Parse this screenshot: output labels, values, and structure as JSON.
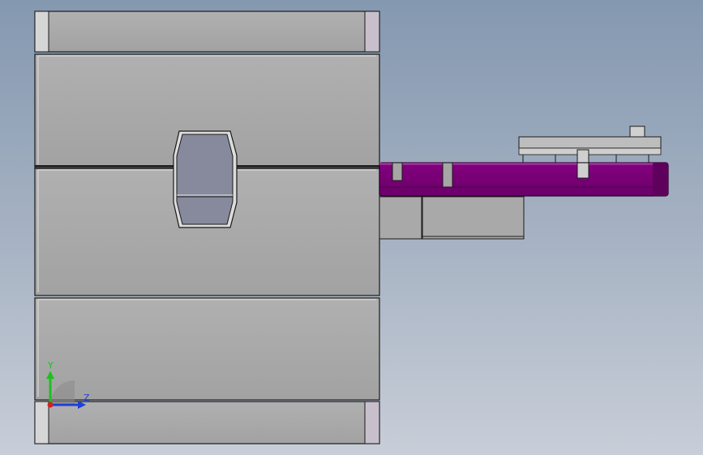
{
  "viewport": {
    "background_top": "#8498b0",
    "background_bottom": "#c8ced8"
  },
  "colors": {
    "plate": "#a6a6a6",
    "plate_edge": "#1a1a1a",
    "plate_highlight": "#d8d8d8",
    "end_cap": "#c9c2cc",
    "cavity": "#868a9e",
    "slider": "#760074",
    "slider_dark": "#4a0049",
    "block": "#a9a9a9",
    "guide": "#bdbdbd"
  },
  "triad": {
    "y_label": "Y",
    "z_label": "Z",
    "y_color": "#1fbf1f",
    "z_color": "#1f3fd6",
    "x_color": "#d61f1f"
  }
}
